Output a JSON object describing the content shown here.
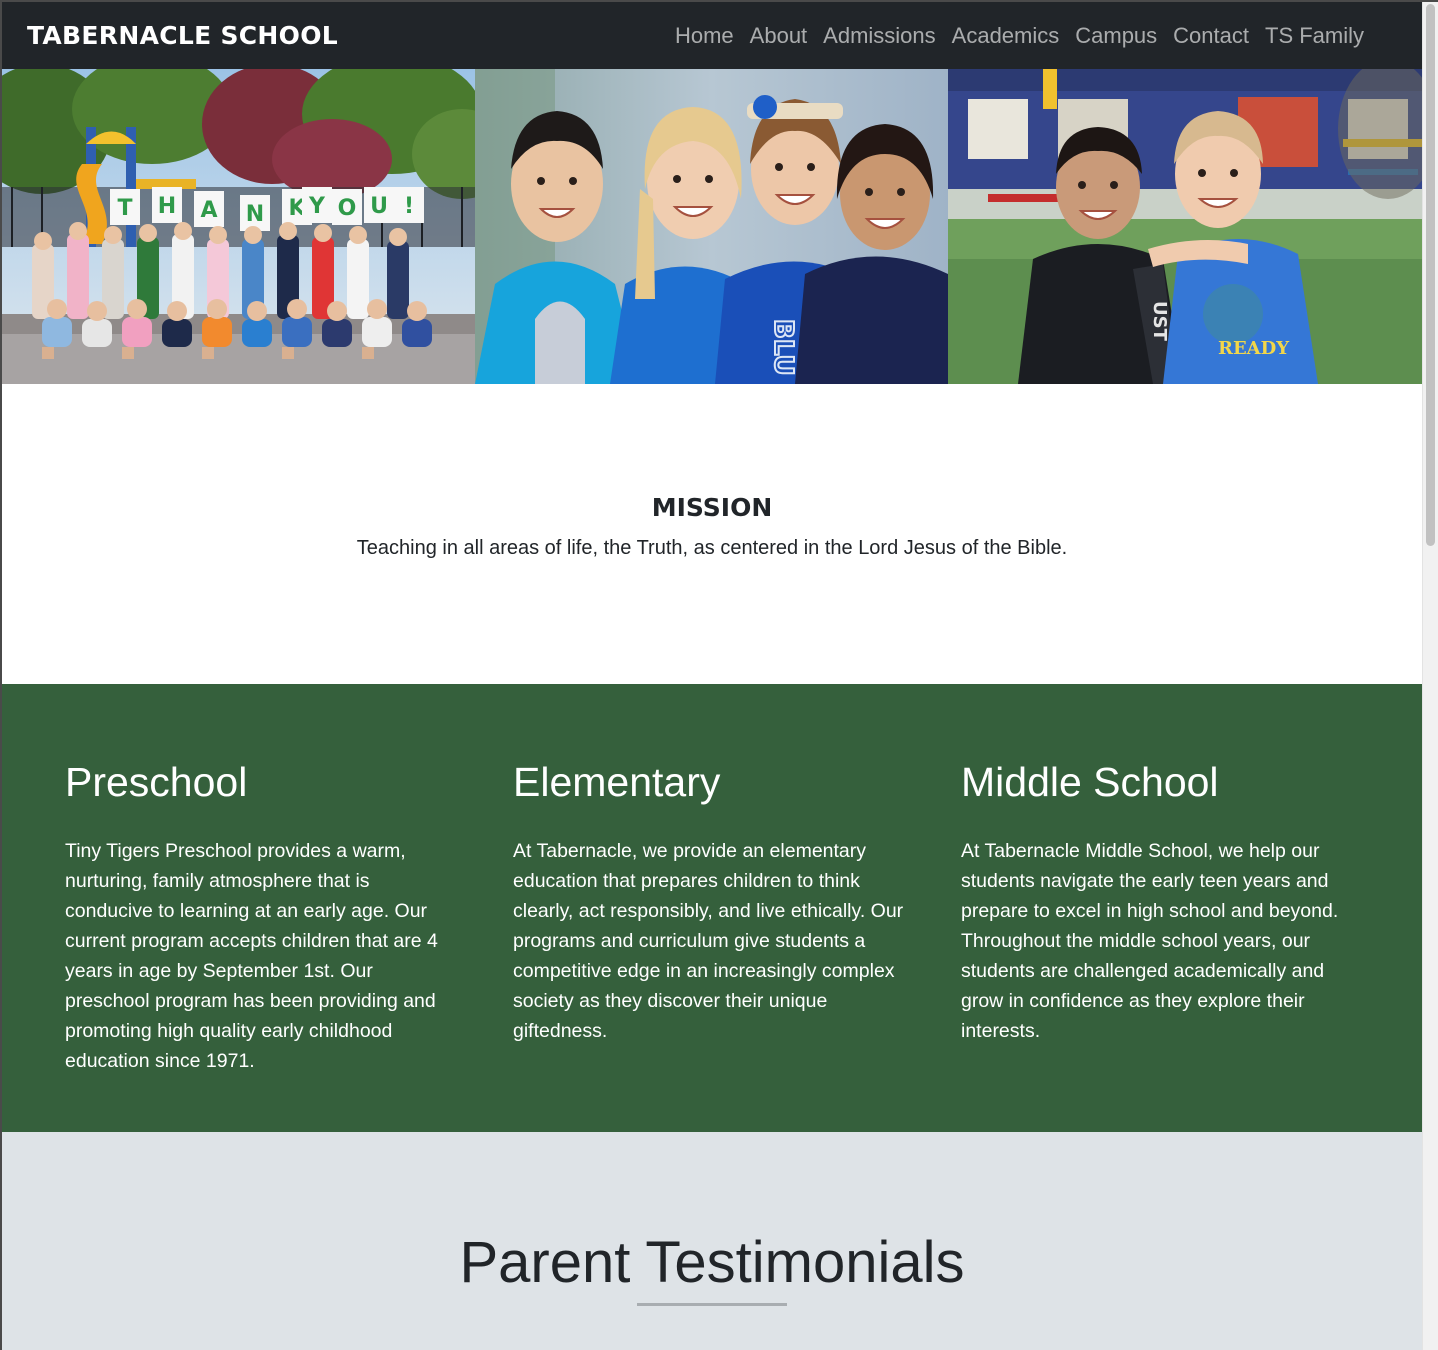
{
  "navbar": {
    "brand": "TABERNACLE SCHOOL",
    "links": [
      "Home",
      "About",
      "Admissions",
      "Academics",
      "Campus",
      "Contact",
      "TS Family"
    ]
  },
  "hero": {
    "photos": [
      {
        "name": "playground-thank-you-photo",
        "sign_letters": [
          "T",
          "H",
          "A",
          "N",
          "K",
          "Y",
          "O",
          "U",
          "!"
        ]
      },
      {
        "name": "four-students-photo",
        "shirt_text": "BLU"
      },
      {
        "name": "two-boys-photo",
        "shirt_text": "READY"
      }
    ]
  },
  "mission": {
    "title": "MISSION",
    "text": "Teaching in all areas of life, the Truth, as centered in the Lord Jesus of the Bible."
  },
  "programs": [
    {
      "title": "Preschool",
      "text": "Tiny Tigers Preschool provides a warm, nurturing, family atmosphere that is conducive to learning at an early age. Our current program accepts children that are 4 years in age by September 1st. Our preschool program has been providing and promoting high quality early childhood education since 1971."
    },
    {
      "title": "Elementary",
      "text": "At Tabernacle, we provide an elementary education that prepares children to think clearly, act responsibly, and live ethically. Our programs and curriculum give students a competitive edge in an increasingly complex society as they discover their unique giftedness."
    },
    {
      "title": "Middle School",
      "text": "At Tabernacle Middle School, we help our students navigate the early teen years and prepare to excel in high school and beyond. Throughout the middle school years, our students are challenged academically and grow in confidence as they explore their interests."
    }
  ],
  "testimonials": {
    "title": "Parent Testimonials"
  },
  "colors": {
    "navbar_bg": "#212529",
    "programs_bg": "#35603c",
    "testimonials_bg": "#dee3e7"
  }
}
